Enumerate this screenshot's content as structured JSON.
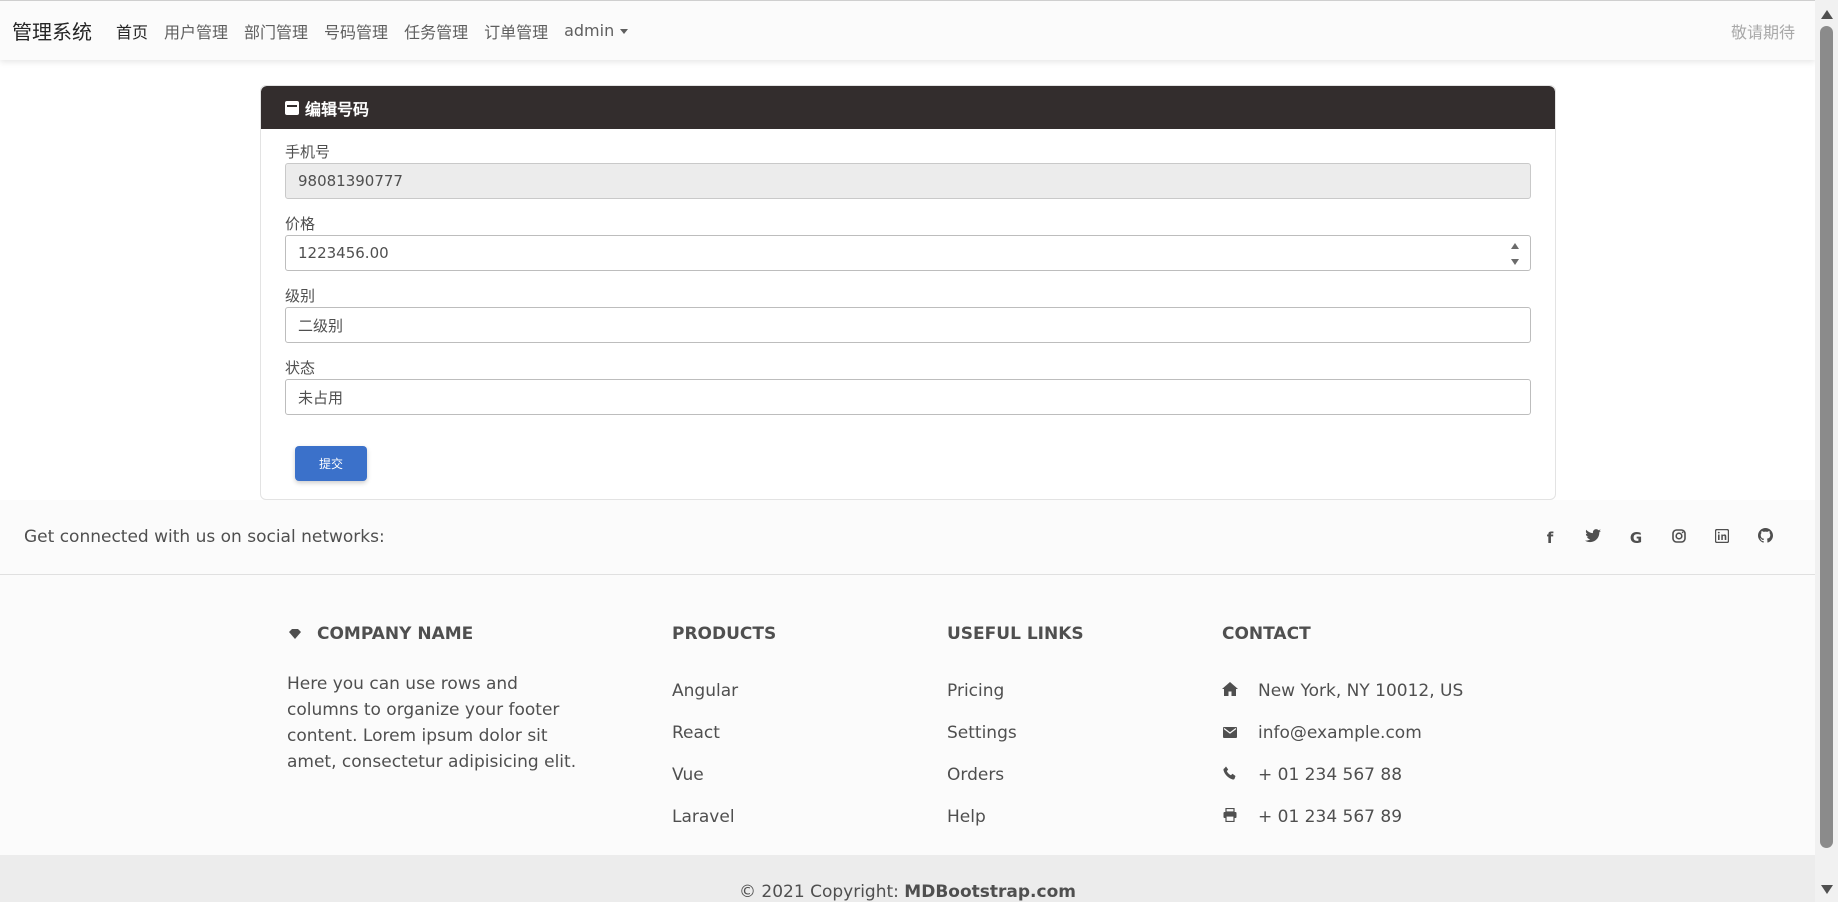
{
  "navbar": {
    "brand": "管理系统",
    "links": [
      "首页",
      "用户管理",
      "部门管理",
      "号码管理",
      "任务管理",
      "订单管理"
    ],
    "dropdown_label": "admin",
    "right_text": "敬请期待"
  },
  "card": {
    "title": "编辑号码",
    "fields": {
      "phone": {
        "label": "手机号",
        "value": "98081390777"
      },
      "price": {
        "label": "价格",
        "value": "1223456.00"
      },
      "level": {
        "label": "级别",
        "value": "二级别"
      },
      "status": {
        "label": "状态",
        "value": "未占用"
      }
    },
    "submit_label": "提交"
  },
  "footer": {
    "social_text": "Get connected with us on social networks:",
    "social_icons": [
      "facebook-icon",
      "twitter-icon",
      "google-icon",
      "instagram-icon",
      "linkedin-icon",
      "github-icon"
    ],
    "company": {
      "title": "COMPANY NAME",
      "description": "Here you can use rows and columns to organize your footer content. Lorem ipsum dolor sit amet, consectetur adipisicing elit."
    },
    "products": {
      "title": "PRODUCTS",
      "items": [
        "Angular",
        "React",
        "Vue",
        "Laravel"
      ]
    },
    "useful_links": {
      "title": "USEFUL LINKS",
      "items": [
        "Pricing",
        "Settings",
        "Orders",
        "Help"
      ]
    },
    "contact": {
      "title": "CONTACT",
      "address": "New York, NY 10012, US",
      "email": "info@example.com",
      "phone": "+ 01 234 567 88",
      "fax": "+ 01 234 567 89"
    },
    "copyright_prefix": "© 2021 Copyright: ",
    "copyright_link": "MDBootstrap.com"
  },
  "colors": {
    "card_header": "#332d2d",
    "submit_button": "#3b71ca",
    "footer_bg": "#fbfbfb"
  }
}
